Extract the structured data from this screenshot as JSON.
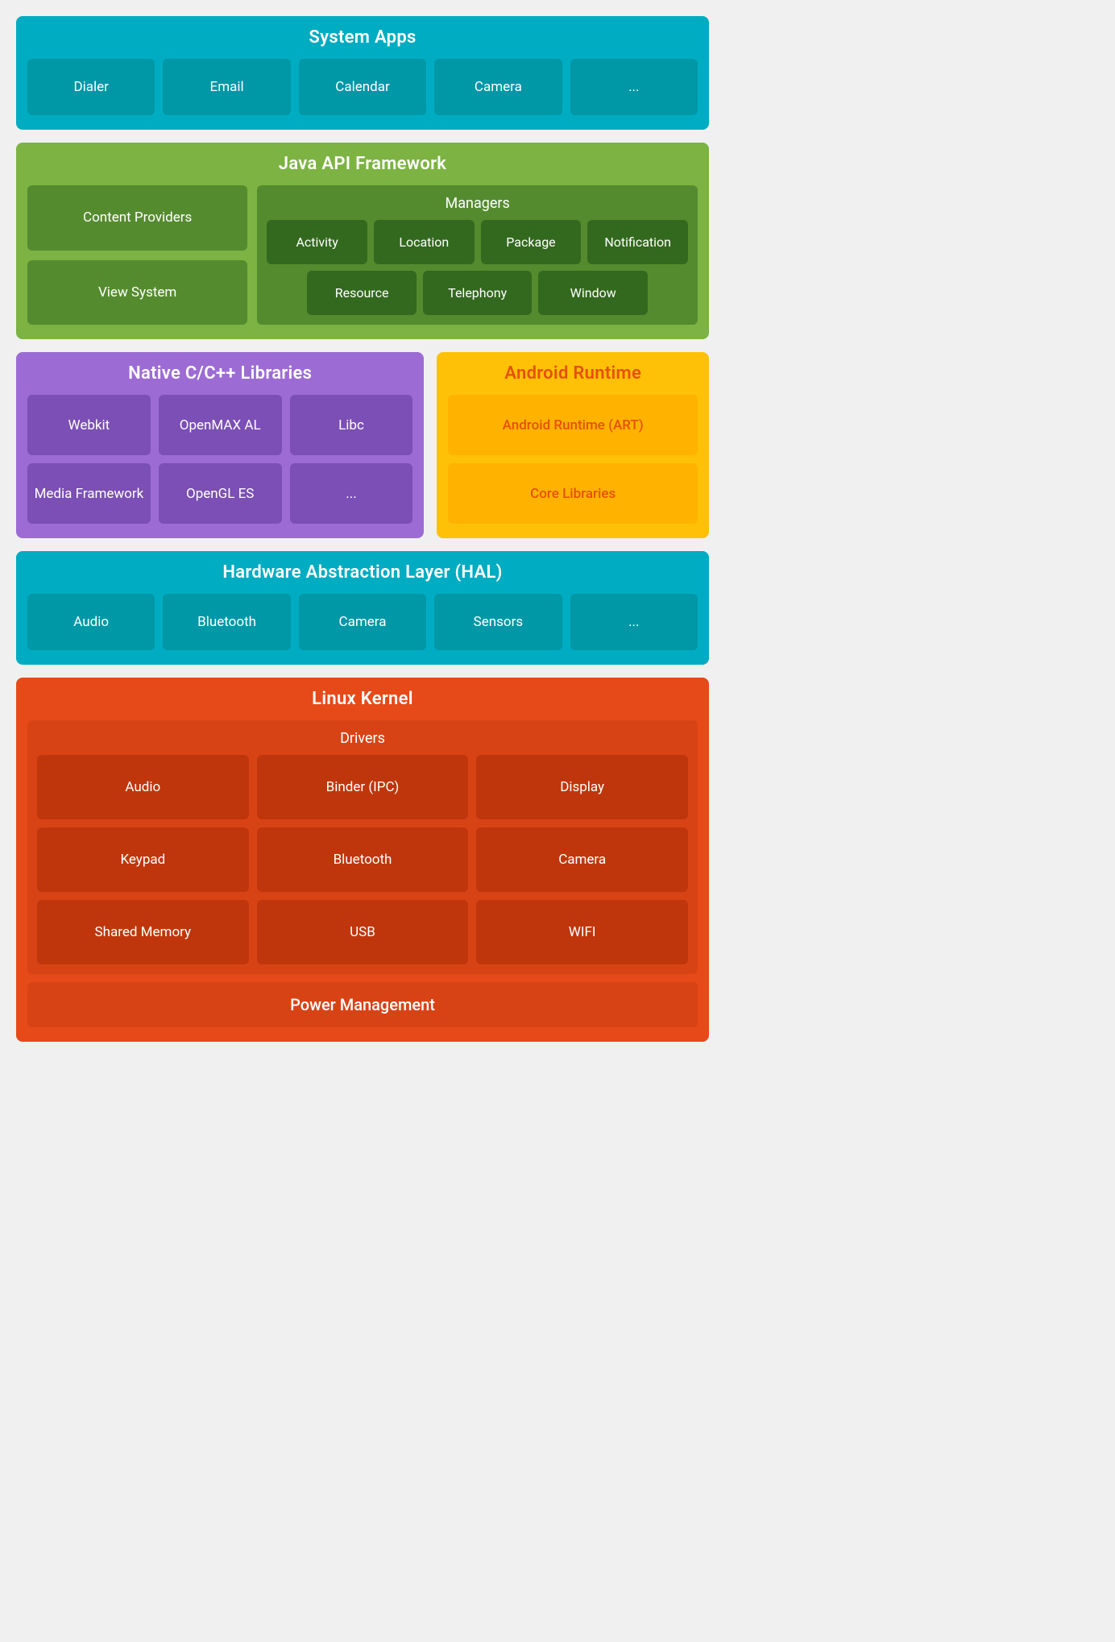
{
  "systemApps": {
    "title": "System Apps",
    "tiles": [
      "Dialer",
      "Email",
      "Calendar",
      "Camera",
      "..."
    ]
  },
  "javaApi": {
    "title": "Java API Framework",
    "leftTiles": [
      "Content Providers",
      "View System"
    ],
    "managers": {
      "label": "Managers",
      "row1": [
        "Activity",
        "Location",
        "Package",
        "Notification"
      ],
      "row2": [
        "Resource",
        "Telephony",
        "Window"
      ]
    }
  },
  "nativeCpp": {
    "title": "Native C/C++ Libraries",
    "tiles": [
      "Webkit",
      "OpenMAX AL",
      "Libc",
      "Media Framework",
      "OpenGL ES",
      "..."
    ]
  },
  "androidRuntime": {
    "title": "Android Runtime",
    "tiles": [
      "Android Runtime (ART)",
      "Core Libraries"
    ]
  },
  "hal": {
    "title": "Hardware Abstraction Layer (HAL)",
    "tiles": [
      "Audio",
      "Bluetooth",
      "Camera",
      "Sensors",
      "..."
    ]
  },
  "linuxKernel": {
    "title": "Linux Kernel",
    "drivers": {
      "label": "Drivers",
      "tiles": [
        "Audio",
        "Binder (IPC)",
        "Display",
        "Keypad",
        "Bluetooth",
        "Camera",
        "Shared Memory",
        "USB",
        "WIFI"
      ]
    },
    "powerManagement": "Power Management"
  }
}
